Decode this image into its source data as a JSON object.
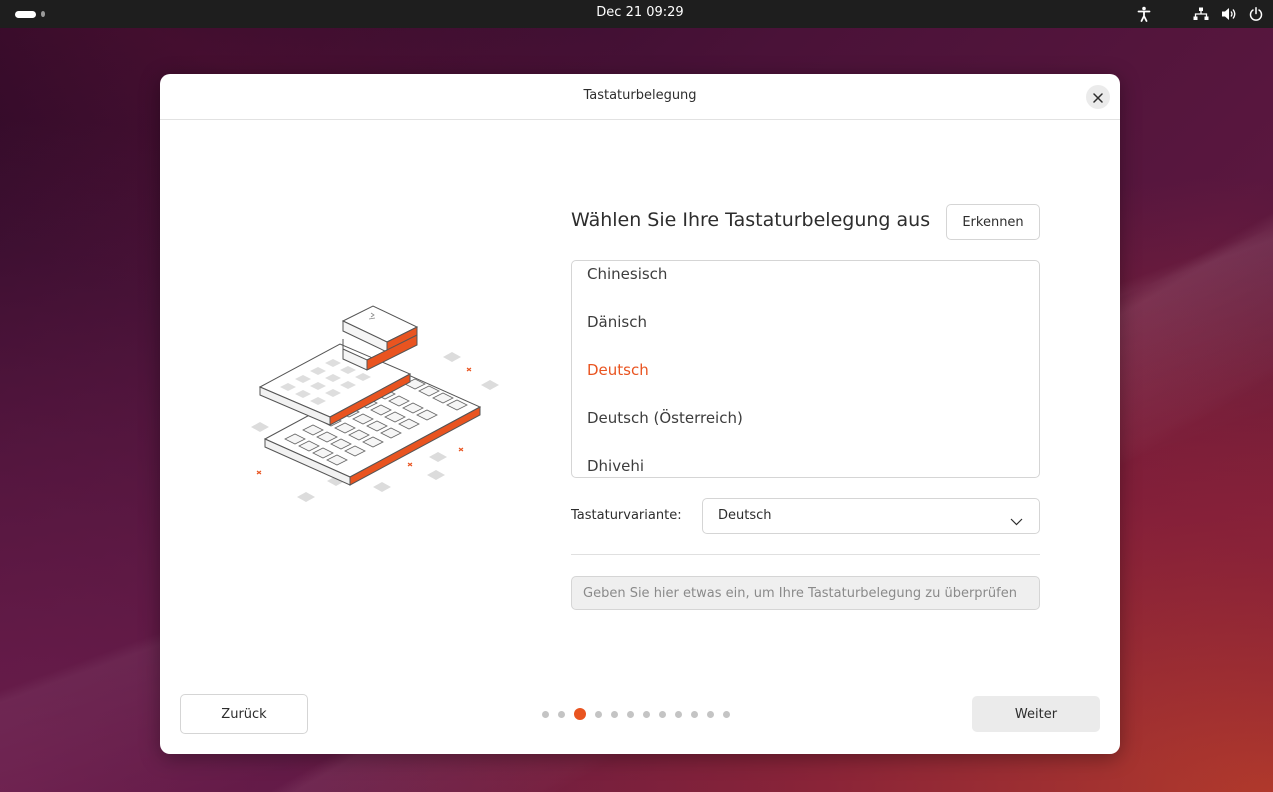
{
  "topbar": {
    "clock": "Dec 21  09:29",
    "tray_icons": [
      "accessibility-icon",
      "network-icon",
      "volume-icon",
      "power-icon"
    ]
  },
  "dialog": {
    "title": "Tastaturbelegung",
    "heading": "Wählen Sie Ihre Tastaturbelegung aus",
    "detect_label": "Erkennen",
    "layouts": [
      "Chinesisch",
      "Dänisch",
      "Deutsch",
      "Deutsch (Österreich)",
      "Dhivehi"
    ],
    "selected_layout": "Deutsch",
    "variant_label": "Tastaturvariante:",
    "variant_value": "Deutsch",
    "test_placeholder": "Geben Sie hier etwas ein, um Ihre Tastaturbelegung zu überprüfen",
    "back_label": "Zurück",
    "next_label": "Weiter"
  },
  "pager": {
    "total": 12,
    "current": 3
  },
  "colors": {
    "accent": "#e95420",
    "topbar": "#1e1e1e"
  }
}
